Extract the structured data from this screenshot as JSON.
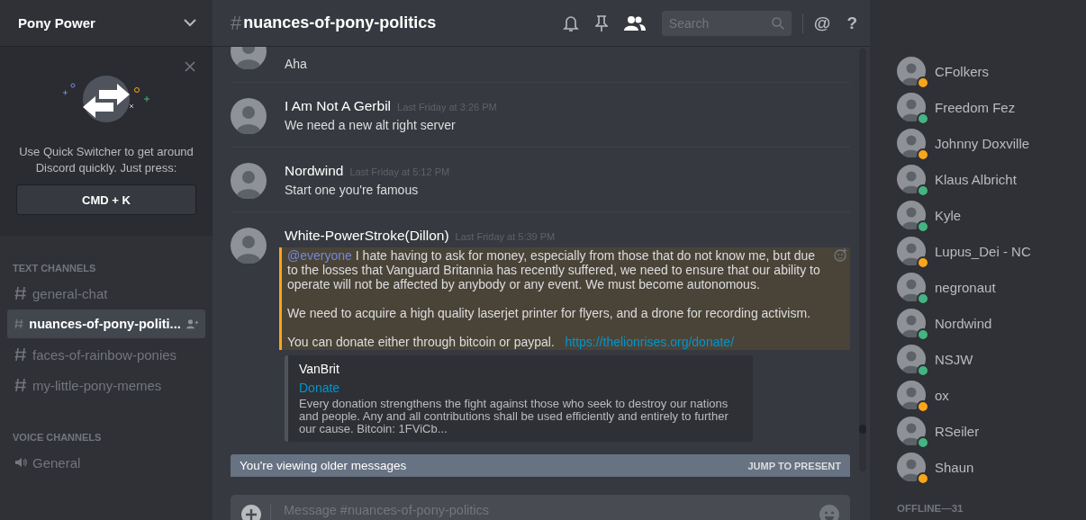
{
  "server": {
    "name": "Pony Power"
  },
  "quick_switcher": {
    "text": "Use Quick Switcher to get around Discord quickly. Just press:",
    "shortcut": "CMD + K"
  },
  "text_channels": {
    "heading": "TEXT CHANNELS",
    "items": [
      {
        "name": "general-chat",
        "selected": false
      },
      {
        "name": "nuances-of-pony-politi...",
        "selected": true
      },
      {
        "name": "faces-of-rainbow-ponies",
        "selected": false
      },
      {
        "name": "my-little-pony-memes",
        "selected": false
      }
    ]
  },
  "voice_channels": {
    "heading": "VOICE CHANNELS",
    "items": [
      {
        "name": "General"
      }
    ]
  },
  "header": {
    "hash": "#",
    "channel": "nuances-of-pony-politics",
    "search_placeholder": "Search",
    "at": "@",
    "help": "?"
  },
  "messages": [
    {
      "text": "Aha"
    },
    {
      "author": "I Am Not A Gerbil",
      "time": "Last Friday at 3:26 PM",
      "text": "We need a new alt right server"
    },
    {
      "author": "Nordwind",
      "time": "Last Friday at 5:12 PM",
      "text": "Start one you're famous"
    },
    {
      "author": "White-PowerStroke(Dillon)",
      "time": "Last Friday at 5:39 PM",
      "highlighted": true,
      "mention": "@everyone",
      "paragraphs": [
        "I hate having to ask for money, especially from those that do not know me, but due to the losses that Vanguard Britannia has recently suffered, we need to ensure that our ability to operate will not be affected by anybody or any event. We must become autonomous.",
        "We need to acquire a high quality laserjet printer for flyers, and a drone for recording activism.",
        "You can donate either through bitcoin or paypal."
      ],
      "link": "https://thelionrises.org/donate/",
      "embed": {
        "provider": "VanBrit",
        "title": "Donate",
        "description": "Every donation strengthens the fight against those who seek to destroy our nations and people. Any and all contributions shall be used efficiently and entirely to further our cause. Bitcoin: 1FViCb..."
      }
    }
  ],
  "older_notice": {
    "text": "You're viewing older messages",
    "action": "JUMP TO PRESENT"
  },
  "composer": {
    "placeholder": "Message #nuances-of-pony-politics"
  },
  "members": [
    {
      "name": "CFolkers",
      "color": "#faa61a"
    },
    {
      "name": "Freedom Fez",
      "color": "#43b581"
    },
    {
      "name": "Johnny Doxville",
      "color": "#faa61a"
    },
    {
      "name": "Klaus Albricht",
      "color": "#43b581"
    },
    {
      "name": "Kyle",
      "color": "#43b581"
    },
    {
      "name": "Lupus_Dei - NC",
      "color": "#faa61a"
    },
    {
      "name": "negronaut",
      "color": "#43b581"
    },
    {
      "name": "Nordwind",
      "color": "#43b581"
    },
    {
      "name": "NSJW",
      "color": "#43b581"
    },
    {
      "name": "ox",
      "color": "#faa61a"
    },
    {
      "name": "RSeiler",
      "color": "#43b581"
    },
    {
      "name": "Shaun",
      "color": "#faa61a"
    }
  ],
  "offline_heading": "OFFLINE—31"
}
